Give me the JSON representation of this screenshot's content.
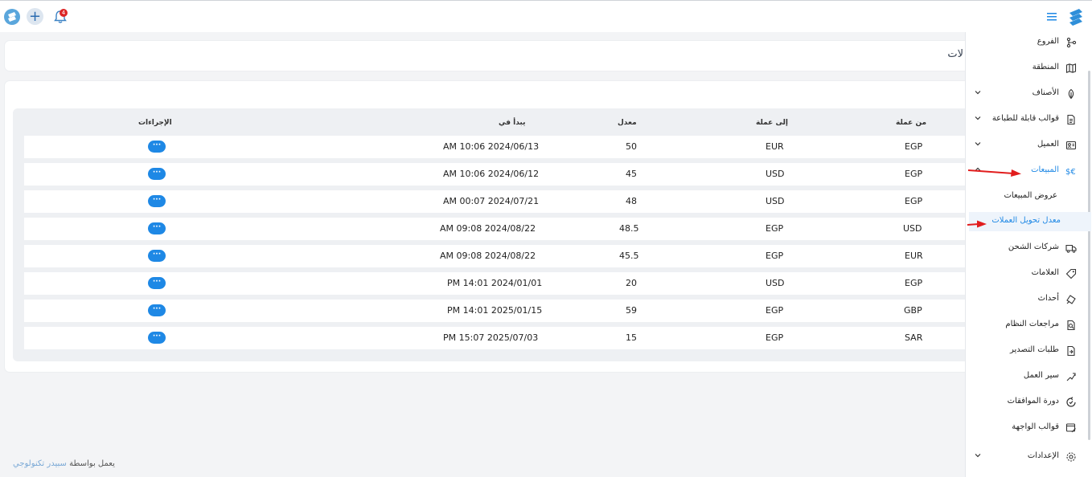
{
  "topbar": {
    "notification_count": "4"
  },
  "header": {
    "title": "معدل تحويل العملات",
    "title_visible": "لات"
  },
  "table": {
    "headers": {
      "from": "من عملة",
      "to": "إلى عملة",
      "rate": "معدل",
      "starts": "يبدأ في",
      "actions": "الإجراءات"
    },
    "action_label": "···",
    "rows": [
      {
        "from": "EGP",
        "to": "EUR",
        "rate": "50",
        "starts": "AM 10:06 2024/06/13"
      },
      {
        "from": "EGP",
        "to": "USD",
        "rate": "45",
        "starts": "AM 10:06 2024/06/12"
      },
      {
        "from": "EGP",
        "to": "USD",
        "rate": "48",
        "starts": "AM 00:07 2024/07/21"
      },
      {
        "from": "USD",
        "to": "EGP",
        "rate": "48.5",
        "starts": "AM 09:08 2024/08/22"
      },
      {
        "from": "EUR",
        "to": "EGP",
        "rate": "45.5",
        "starts": "AM 09:08 2024/08/22"
      },
      {
        "from": "EGP",
        "to": "USD",
        "rate": "20",
        "starts": "PM 14:01 2024/01/01"
      },
      {
        "from": "GBP",
        "to": "EGP",
        "rate": "59",
        "starts": "PM 14:01 2025/01/15"
      },
      {
        "from": "SAR",
        "to": "EGP",
        "rate": "15",
        "starts": "PM 15:07 2025/07/03"
      }
    ]
  },
  "sidebar": {
    "items": [
      {
        "label": "الفروع",
        "icon": "branch-icon"
      },
      {
        "label": "المنطقة",
        "icon": "map-icon"
      },
      {
        "label": "الأصناف",
        "icon": "leaf-icon"
      },
      {
        "label": "قوالب قابلة للطباعة",
        "icon": "document-icon"
      },
      {
        "label": "العميل",
        "icon": "customer-icon"
      },
      {
        "label": "المبيعات",
        "icon": "currency-icon"
      },
      {
        "label": "شركات الشحن",
        "icon": "truck-icon"
      },
      {
        "label": "العلامات",
        "icon": "tag-icon"
      },
      {
        "label": "أحداث",
        "icon": "event-icon"
      },
      {
        "label": "مراجعات النظام",
        "icon": "audit-icon"
      },
      {
        "label": "طلبات التصدير",
        "icon": "export-icon"
      },
      {
        "label": "سير العمل",
        "icon": "workflow-icon"
      },
      {
        "label": "دورة الموافقات",
        "icon": "cycle-icon"
      },
      {
        "label": "قوالب الواجهة",
        "icon": "template-icon"
      },
      {
        "label": "الإعدادات",
        "icon": "gear-icon"
      }
    ],
    "subitems": [
      {
        "label": "عروض المبيعات"
      },
      {
        "label": "معدل تحويل العملات"
      }
    ]
  },
  "footer": {
    "prefix": "يعمل بواسطة",
    "link": "سبيدر تكنولوجي"
  },
  "colors": {
    "accent": "#1e88e5",
    "badge": "#dc2626",
    "annotation_arrow": "#e11d1d"
  }
}
